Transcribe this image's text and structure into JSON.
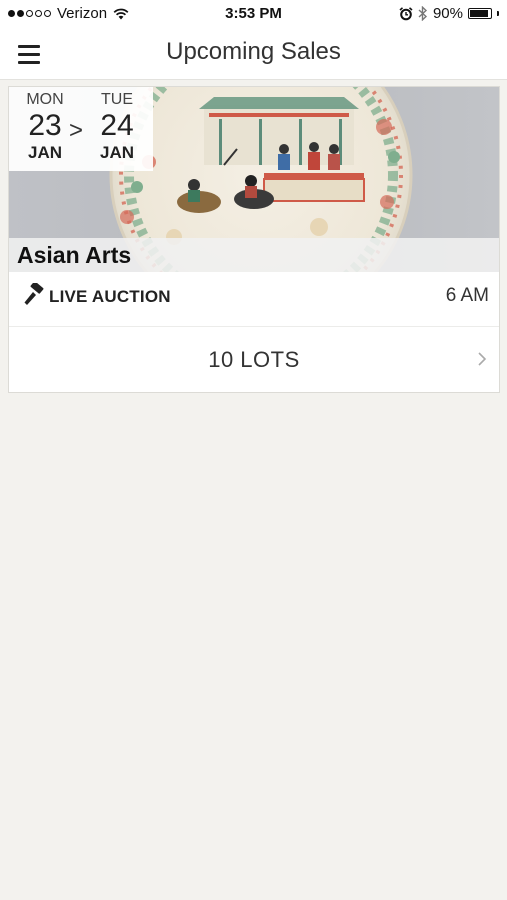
{
  "status_bar": {
    "carrier": "Verizon",
    "time": "3:53 PM",
    "battery": "90%",
    "signal_bars_filled": 2,
    "signal_bars_total": 5,
    "battery_level": 0.9
  },
  "nav": {
    "title": "Upcoming Sales",
    "menu_icon": "hamburger-menu-icon"
  },
  "sale": {
    "start": {
      "weekday": "MON",
      "day": "23",
      "month": "JAN"
    },
    "arrow": ">",
    "end": {
      "weekday": "TUE",
      "day": "24",
      "month": "JAN"
    },
    "title": "Asian Arts",
    "auction_type": "LIVE AUCTION",
    "auction_icon": "gavel-icon",
    "time": "6 AM",
    "lots": "10 LOTS",
    "lots_icon": "chevron-right-icon"
  },
  "colors": {
    "background": "#f3f2ee",
    "card": "#ffffff",
    "text": "#222222"
  }
}
